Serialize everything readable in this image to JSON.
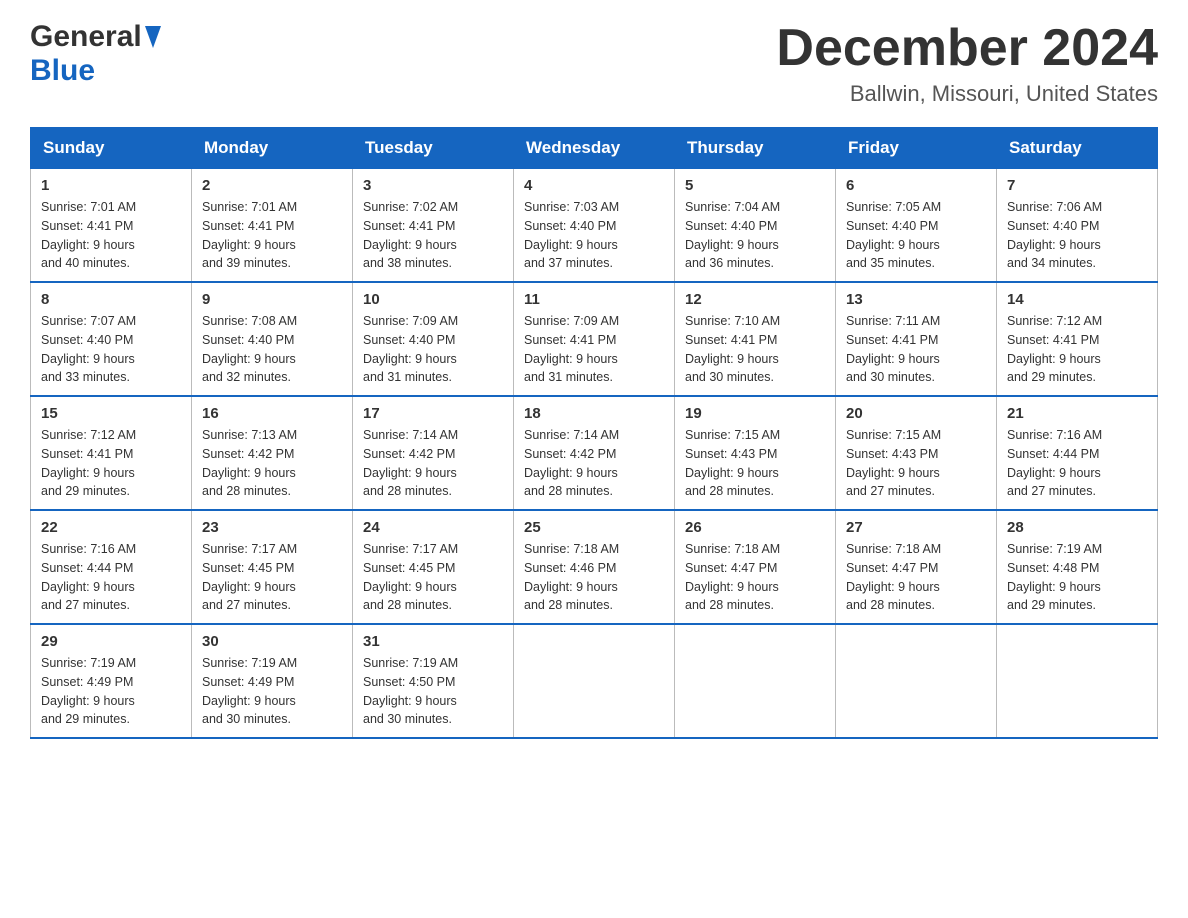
{
  "header": {
    "logo_general": "General",
    "logo_blue": "Blue",
    "title": "December 2024",
    "subtitle": "Ballwin, Missouri, United States"
  },
  "days_of_week": [
    "Sunday",
    "Monday",
    "Tuesday",
    "Wednesday",
    "Thursday",
    "Friday",
    "Saturday"
  ],
  "weeks": [
    [
      {
        "day": "1",
        "sunrise": "7:01 AM",
        "sunset": "4:41 PM",
        "daylight": "9 hours and 40 minutes."
      },
      {
        "day": "2",
        "sunrise": "7:01 AM",
        "sunset": "4:41 PM",
        "daylight": "9 hours and 39 minutes."
      },
      {
        "day": "3",
        "sunrise": "7:02 AM",
        "sunset": "4:41 PM",
        "daylight": "9 hours and 38 minutes."
      },
      {
        "day": "4",
        "sunrise": "7:03 AM",
        "sunset": "4:40 PM",
        "daylight": "9 hours and 37 minutes."
      },
      {
        "day": "5",
        "sunrise": "7:04 AM",
        "sunset": "4:40 PM",
        "daylight": "9 hours and 36 minutes."
      },
      {
        "day": "6",
        "sunrise": "7:05 AM",
        "sunset": "4:40 PM",
        "daylight": "9 hours and 35 minutes."
      },
      {
        "day": "7",
        "sunrise": "7:06 AM",
        "sunset": "4:40 PM",
        "daylight": "9 hours and 34 minutes."
      }
    ],
    [
      {
        "day": "8",
        "sunrise": "7:07 AM",
        "sunset": "4:40 PM",
        "daylight": "9 hours and 33 minutes."
      },
      {
        "day": "9",
        "sunrise": "7:08 AM",
        "sunset": "4:40 PM",
        "daylight": "9 hours and 32 minutes."
      },
      {
        "day": "10",
        "sunrise": "7:09 AM",
        "sunset": "4:40 PM",
        "daylight": "9 hours and 31 minutes."
      },
      {
        "day": "11",
        "sunrise": "7:09 AM",
        "sunset": "4:41 PM",
        "daylight": "9 hours and 31 minutes."
      },
      {
        "day": "12",
        "sunrise": "7:10 AM",
        "sunset": "4:41 PM",
        "daylight": "9 hours and 30 minutes."
      },
      {
        "day": "13",
        "sunrise": "7:11 AM",
        "sunset": "4:41 PM",
        "daylight": "9 hours and 30 minutes."
      },
      {
        "day": "14",
        "sunrise": "7:12 AM",
        "sunset": "4:41 PM",
        "daylight": "9 hours and 29 minutes."
      }
    ],
    [
      {
        "day": "15",
        "sunrise": "7:12 AM",
        "sunset": "4:41 PM",
        "daylight": "9 hours and 29 minutes."
      },
      {
        "day": "16",
        "sunrise": "7:13 AM",
        "sunset": "4:42 PM",
        "daylight": "9 hours and 28 minutes."
      },
      {
        "day": "17",
        "sunrise": "7:14 AM",
        "sunset": "4:42 PM",
        "daylight": "9 hours and 28 minutes."
      },
      {
        "day": "18",
        "sunrise": "7:14 AM",
        "sunset": "4:42 PM",
        "daylight": "9 hours and 28 minutes."
      },
      {
        "day": "19",
        "sunrise": "7:15 AM",
        "sunset": "4:43 PM",
        "daylight": "9 hours and 28 minutes."
      },
      {
        "day": "20",
        "sunrise": "7:15 AM",
        "sunset": "4:43 PM",
        "daylight": "9 hours and 27 minutes."
      },
      {
        "day": "21",
        "sunrise": "7:16 AM",
        "sunset": "4:44 PM",
        "daylight": "9 hours and 27 minutes."
      }
    ],
    [
      {
        "day": "22",
        "sunrise": "7:16 AM",
        "sunset": "4:44 PM",
        "daylight": "9 hours and 27 minutes."
      },
      {
        "day": "23",
        "sunrise": "7:17 AM",
        "sunset": "4:45 PM",
        "daylight": "9 hours and 27 minutes."
      },
      {
        "day": "24",
        "sunrise": "7:17 AM",
        "sunset": "4:45 PM",
        "daylight": "9 hours and 28 minutes."
      },
      {
        "day": "25",
        "sunrise": "7:18 AM",
        "sunset": "4:46 PM",
        "daylight": "9 hours and 28 minutes."
      },
      {
        "day": "26",
        "sunrise": "7:18 AM",
        "sunset": "4:47 PM",
        "daylight": "9 hours and 28 minutes."
      },
      {
        "day": "27",
        "sunrise": "7:18 AM",
        "sunset": "4:47 PM",
        "daylight": "9 hours and 28 minutes."
      },
      {
        "day": "28",
        "sunrise": "7:19 AM",
        "sunset": "4:48 PM",
        "daylight": "9 hours and 29 minutes."
      }
    ],
    [
      {
        "day": "29",
        "sunrise": "7:19 AM",
        "sunset": "4:49 PM",
        "daylight": "9 hours and 29 minutes."
      },
      {
        "day": "30",
        "sunrise": "7:19 AM",
        "sunset": "4:49 PM",
        "daylight": "9 hours and 30 minutes."
      },
      {
        "day": "31",
        "sunrise": "7:19 AM",
        "sunset": "4:50 PM",
        "daylight": "9 hours and 30 minutes."
      },
      null,
      null,
      null,
      null
    ]
  ],
  "labels": {
    "sunrise": "Sunrise:",
    "sunset": "Sunset:",
    "daylight": "Daylight:"
  }
}
